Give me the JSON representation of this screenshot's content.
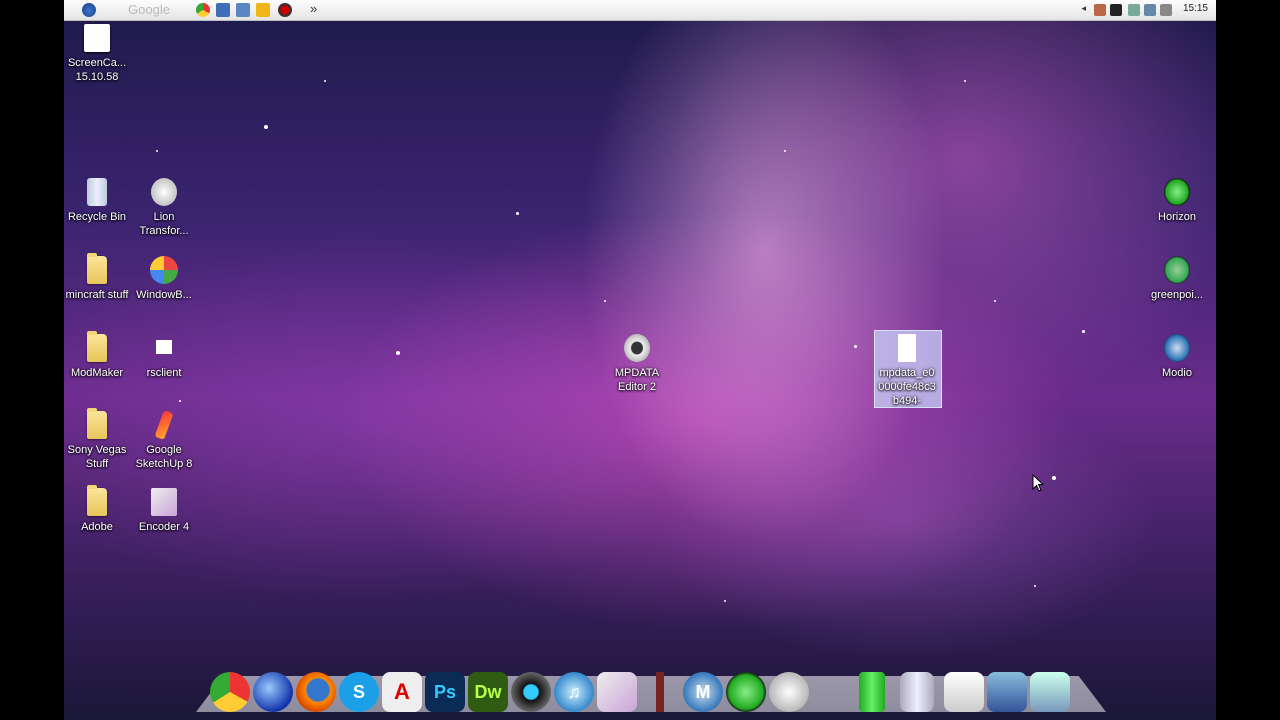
{
  "menubar": {
    "search_placeholder": "Google",
    "clock": "15:15",
    "more_glyph": "»"
  },
  "desktop_icons": {
    "screencapture": "ScreenCa... 15.10.58",
    "recycle_bin": "Recycle Bin",
    "lion_transformation": "Lion Transfor...",
    "mincraft_stuff": "mincraft stuff",
    "windowblinds": "WindowB...",
    "modmaker": "ModMaker",
    "rsclient": "rsclient",
    "sony_vegas": "Sony Vegas Stuff",
    "sketchup": "Google SketchUp 8",
    "adobe": "Adobe",
    "encoder": "Encoder 4",
    "mpdata_editor": "MPDATA Editor 2",
    "mpdata_file": "mpdata_e00000fe48c3b494-",
    "horizon": "Horizon",
    "greenpois0n": "greenpoi...",
    "modio": "Modio"
  },
  "dock": {
    "photoshop": "Ps",
    "dreamweaver": "Dw",
    "acrobat": "A",
    "modio": "M"
  },
  "colors": {
    "wallpaper_pink": "#d865c8",
    "wallpaper_deep": "#2a1f5a"
  }
}
